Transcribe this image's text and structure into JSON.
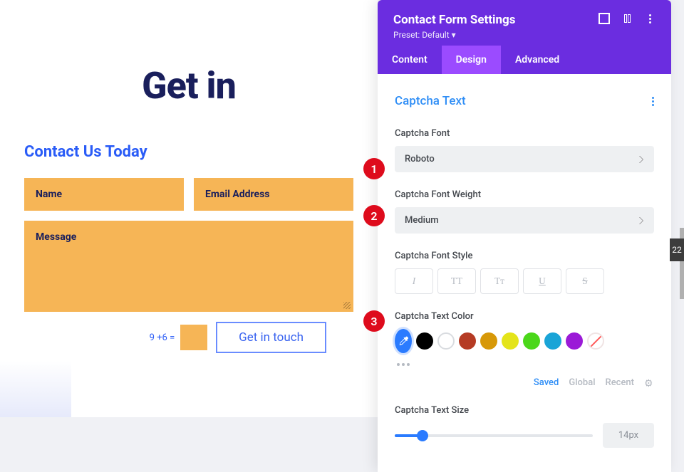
{
  "page": {
    "title": "Get in",
    "form_heading": "Contact Us Today",
    "fields": {
      "name": "Name",
      "email": "Email Address",
      "message": "Message"
    },
    "captcha_question": "9 +6 =",
    "submit_label": "Get in touch"
  },
  "panel": {
    "title": "Contact Form Settings",
    "preset": "Preset: Default",
    "tabs": {
      "content": "Content",
      "design": "Design",
      "advanced": "Advanced"
    },
    "section": "Captcha Text",
    "labels": {
      "font": "Captcha Font",
      "weight": "Captcha Font Weight",
      "style": "Captcha Font Style",
      "color": "Captcha Text Color",
      "size": "Captcha Text Size"
    },
    "values": {
      "font": "Roboto",
      "weight": "Medium",
      "size": "14px",
      "slider_pct": 14
    },
    "style_glyphs": {
      "italic": "I",
      "uppercase": "TT",
      "smallcaps": "Tᴛ",
      "underline": "U",
      "strike": "S"
    },
    "swatches": [
      "#2a7bff",
      "#000000",
      "hollow",
      "#b53b24",
      "#d79808",
      "#e4e41a",
      "#4bd71a",
      "#1aa4d7",
      "#9b1ad7",
      "none"
    ],
    "swatch_tabs": {
      "saved": "Saved",
      "global": "Global",
      "recent": "Recent"
    }
  },
  "markers": {
    "one": "1",
    "two": "2",
    "three": "3"
  },
  "edge": "22"
}
